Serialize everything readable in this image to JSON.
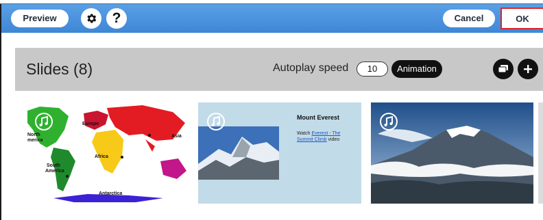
{
  "toolbar": {
    "preview_label": "Preview",
    "help_label": "?",
    "cancel_label": "Cancel",
    "ok_label": "OK"
  },
  "slides": {
    "title": "Slides (8)",
    "autoplay_label": "Autoplay speed",
    "autoplay_value": "10",
    "animation_label": "Animation"
  },
  "thumbnails": [
    {
      "labels": [
        "Europe",
        "North",
        "merica",
        "Asia",
        "Africa",
        "South",
        "America",
        "Antarctica"
      ]
    },
    {
      "title": "Mount Everest",
      "text_before": "Watch ",
      "link_text": "Everest - The Summit Climb",
      "text_after": " video"
    },
    {}
  ],
  "colors": {
    "toolbar_blue": "#3f86d6",
    "ok_border": "#d9252a",
    "panel_header": "#c8c8c8"
  },
  "icons": [
    "gear-icon",
    "help-icon",
    "copy-slides-icon",
    "plus-icon",
    "music-note-icon"
  ]
}
